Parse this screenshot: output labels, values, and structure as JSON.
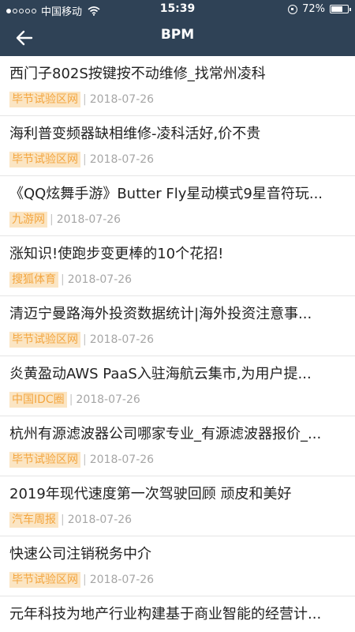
{
  "status_bar": {
    "carrier": "中国移动",
    "time": "15:39",
    "battery_text": "72%",
    "battery_level": 0.72
  },
  "nav": {
    "title": "BPM"
  },
  "articles": [
    {
      "title": "西门子802S按键按不动维修_找常州凌科",
      "source": "毕节试验区网",
      "date": "2018-07-26"
    },
    {
      "title": "海利普变频器缺相维修-凌科活好,价不贵",
      "source": "毕节试验区网",
      "date": "2018-07-26"
    },
    {
      "title": "《QQ炫舞手游》Butter Fly星动模式9星音符玩...",
      "source": "九游网",
      "date": "2018-07-26"
    },
    {
      "title": "涨知识!使跑步变更棒的10个花招!",
      "source": "搜狐体育",
      "date": "2018-07-26"
    },
    {
      "title": "清迈宁曼路海外投资数据统计|海外投资注意事...",
      "source": "毕节试验区网",
      "date": "2018-07-26"
    },
    {
      "title": "炎黄盈动AWS PaaS入驻海航云集市,为用户提...",
      "source": "中国IDC圈",
      "date": "2018-07-26"
    },
    {
      "title": "杭州有源滤波器公司哪家专业_有源滤波器报价_...",
      "source": "毕节试验区网",
      "date": "2018-07-26"
    },
    {
      "title": "2019年现代速度第一次驾驶回顾 顽皮和美好",
      "source": "汽车周报",
      "date": "2018-07-26"
    },
    {
      "title": "快速公司注销税务中介",
      "source": "毕节试验区网",
      "date": "2018-07-26"
    },
    {
      "title": "元年科技为地产行业构建基于商业智能的经营计...",
      "source": "",
      "date": ""
    }
  ],
  "colors": {
    "header_bg": "#2f4256",
    "source_bg": "#fbe5c3",
    "source_text": "#f3a640",
    "title_text": "#222222",
    "meta_text": "#a6a6a6"
  },
  "icons": {
    "back": "arrow-left-icon",
    "wifi": "wifi-icon",
    "rotation_lock": "rotation-lock-icon",
    "battery": "battery-icon"
  }
}
